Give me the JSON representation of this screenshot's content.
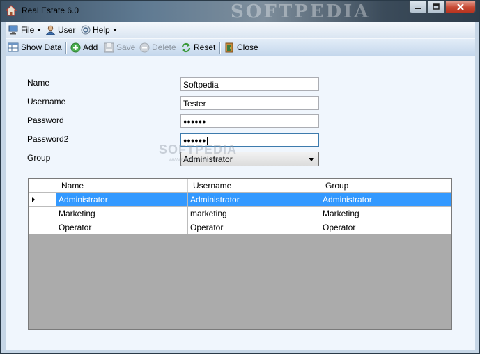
{
  "window": {
    "title": "Real Estate 6.0",
    "watermark": "SOFTPEDIA"
  },
  "menu": {
    "items": [
      {
        "label": "File"
      },
      {
        "label": "User"
      },
      {
        "label": "Help"
      }
    ]
  },
  "toolbar": {
    "show_data": "Show Data",
    "add": "Add",
    "save": "Save",
    "delete": "Delete",
    "reset": "Reset",
    "close": "Close"
  },
  "form": {
    "name_label": "Name",
    "name_value": "Softpedia",
    "username_label": "Username",
    "username_value": "Tester",
    "password_label": "Password",
    "password_value": "●●●●●●",
    "password2_label": "Password2",
    "password2_value": "●●●●●●",
    "group_label": "Group",
    "group_value": "Administrator"
  },
  "center_watermark": {
    "big": "SOFTPEDIA",
    "small": "www.softpedia.com"
  },
  "grid": {
    "columns": [
      "Name",
      "Username",
      "Group"
    ],
    "rows": [
      [
        "Administrator",
        "Administrator",
        "Administrator"
      ],
      [
        "Marketing",
        "marketing",
        "Marketing"
      ],
      [
        "Operator",
        "Operator",
        "Operator"
      ]
    ],
    "selected_row": 0
  },
  "colors": {
    "selection": "#3399ff",
    "grid_background": "#ababab",
    "close_button": "#c74a35"
  }
}
